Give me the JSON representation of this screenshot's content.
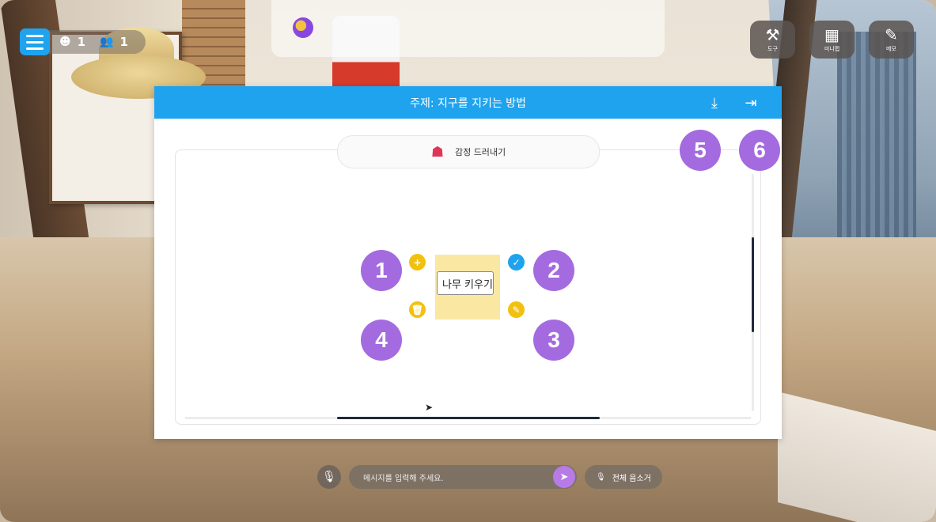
{
  "hud": {
    "menu_icon": "hamburger-menu-icon",
    "user_count": "1",
    "group_count": "1",
    "tools": [
      {
        "label": "도구",
        "icon": "tools-icon"
      },
      {
        "label": "미니맵",
        "icon": "minimap-icon"
      },
      {
        "label": "메모",
        "icon": "memo-icon"
      }
    ]
  },
  "modal": {
    "title": "주제: 지구를 지키는 방법",
    "emotion_label": "감정 드러내기",
    "note_text": "나무 키우기",
    "header_color": "#1fa3ee",
    "note_color": "#fae8a2"
  },
  "badges": [
    "1",
    "2",
    "3",
    "4",
    "5",
    "6"
  ],
  "chat": {
    "placeholder": "메시지를 입력해 주세요.",
    "mute_all_label": "전체 음소거"
  },
  "colors": {
    "accent_blue": "#1fa3ee",
    "badge_purple": "#a46be0",
    "action_yellow": "#f2c10f"
  }
}
